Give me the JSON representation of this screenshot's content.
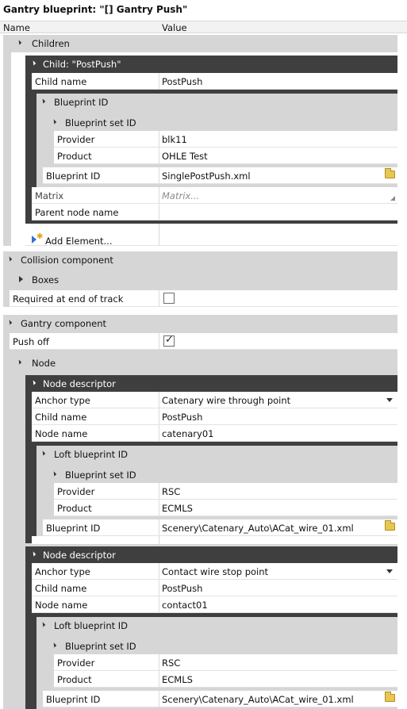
{
  "window": {
    "title": "Gantry blueprint: \"[] Gantry Push\""
  },
  "columns": {
    "name": "Name",
    "value": "Value"
  },
  "children_group": {
    "label": "Children",
    "child": {
      "header": "Child: \"PostPush\"",
      "child_name_label": "Child name",
      "child_name_value": "PostPush",
      "blueprint_id_group": "Blueprint ID",
      "blueprint_set_id_group": "Blueprint set ID",
      "provider_label": "Provider",
      "provider_value": "blk11",
      "product_label": "Product",
      "product_value": "OHLE Test",
      "blueprint_id_label": "Blueprint ID",
      "blueprint_id_value": "SinglePostPush.xml",
      "matrix_label": "Matrix",
      "matrix_value": "Matrix...",
      "parent_node_label": "Parent node name",
      "parent_node_value": ""
    },
    "add_element": "Add Element..."
  },
  "collision_group": {
    "label": "Collision component",
    "boxes_label": "Boxes",
    "required_label": "Required at end of track",
    "required_checked": false
  },
  "gantry_group": {
    "label": "Gantry component",
    "push_off_label": "Push off",
    "push_off_checked": true,
    "node_label": "Node",
    "descriptors": [
      {
        "header": "Node descriptor",
        "anchor_type_label": "Anchor type",
        "anchor_type_value": "Catenary wire through point",
        "child_name_label": "Child name",
        "child_name_value": "PostPush",
        "node_name_label": "Node name",
        "node_name_value": "catenary01",
        "loft_label": "Loft blueprint ID",
        "set_label": "Blueprint set ID",
        "provider_label": "Provider",
        "provider_value": "RSC",
        "product_label": "Product",
        "product_value": "ECMLS",
        "blueprint_id_label": "Blueprint ID",
        "blueprint_id_value": "Scenery\\Catenary_Auto\\ACat_wire_01.xml"
      },
      {
        "header": "Node descriptor",
        "anchor_type_label": "Anchor type",
        "anchor_type_value": "Contact wire stop point",
        "child_name_label": "Child name",
        "child_name_value": "PostPush",
        "node_name_label": "Node name",
        "node_name_value": "contact01",
        "loft_label": "Loft blueprint ID",
        "set_label": "Blueprint set ID",
        "provider_label": "Provider",
        "provider_value": "RSC",
        "product_label": "Product",
        "product_value": "ECMLS",
        "blueprint_id_label": "Blueprint ID",
        "blueprint_id_value": "Scenery\\Catenary_Auto\\ACat_wire_01.xml"
      }
    ]
  },
  "icons": {
    "expander": "triangle-down-icon",
    "collapsed": "triangle-right-icon",
    "browse": "folder-icon",
    "dropdown": "chevron-down-icon",
    "checkmark": "✓"
  },
  "colors": {
    "group_light": "#d6d6d6",
    "group_dark": "#3f3f3f",
    "row_bg": "#ffffff"
  }
}
